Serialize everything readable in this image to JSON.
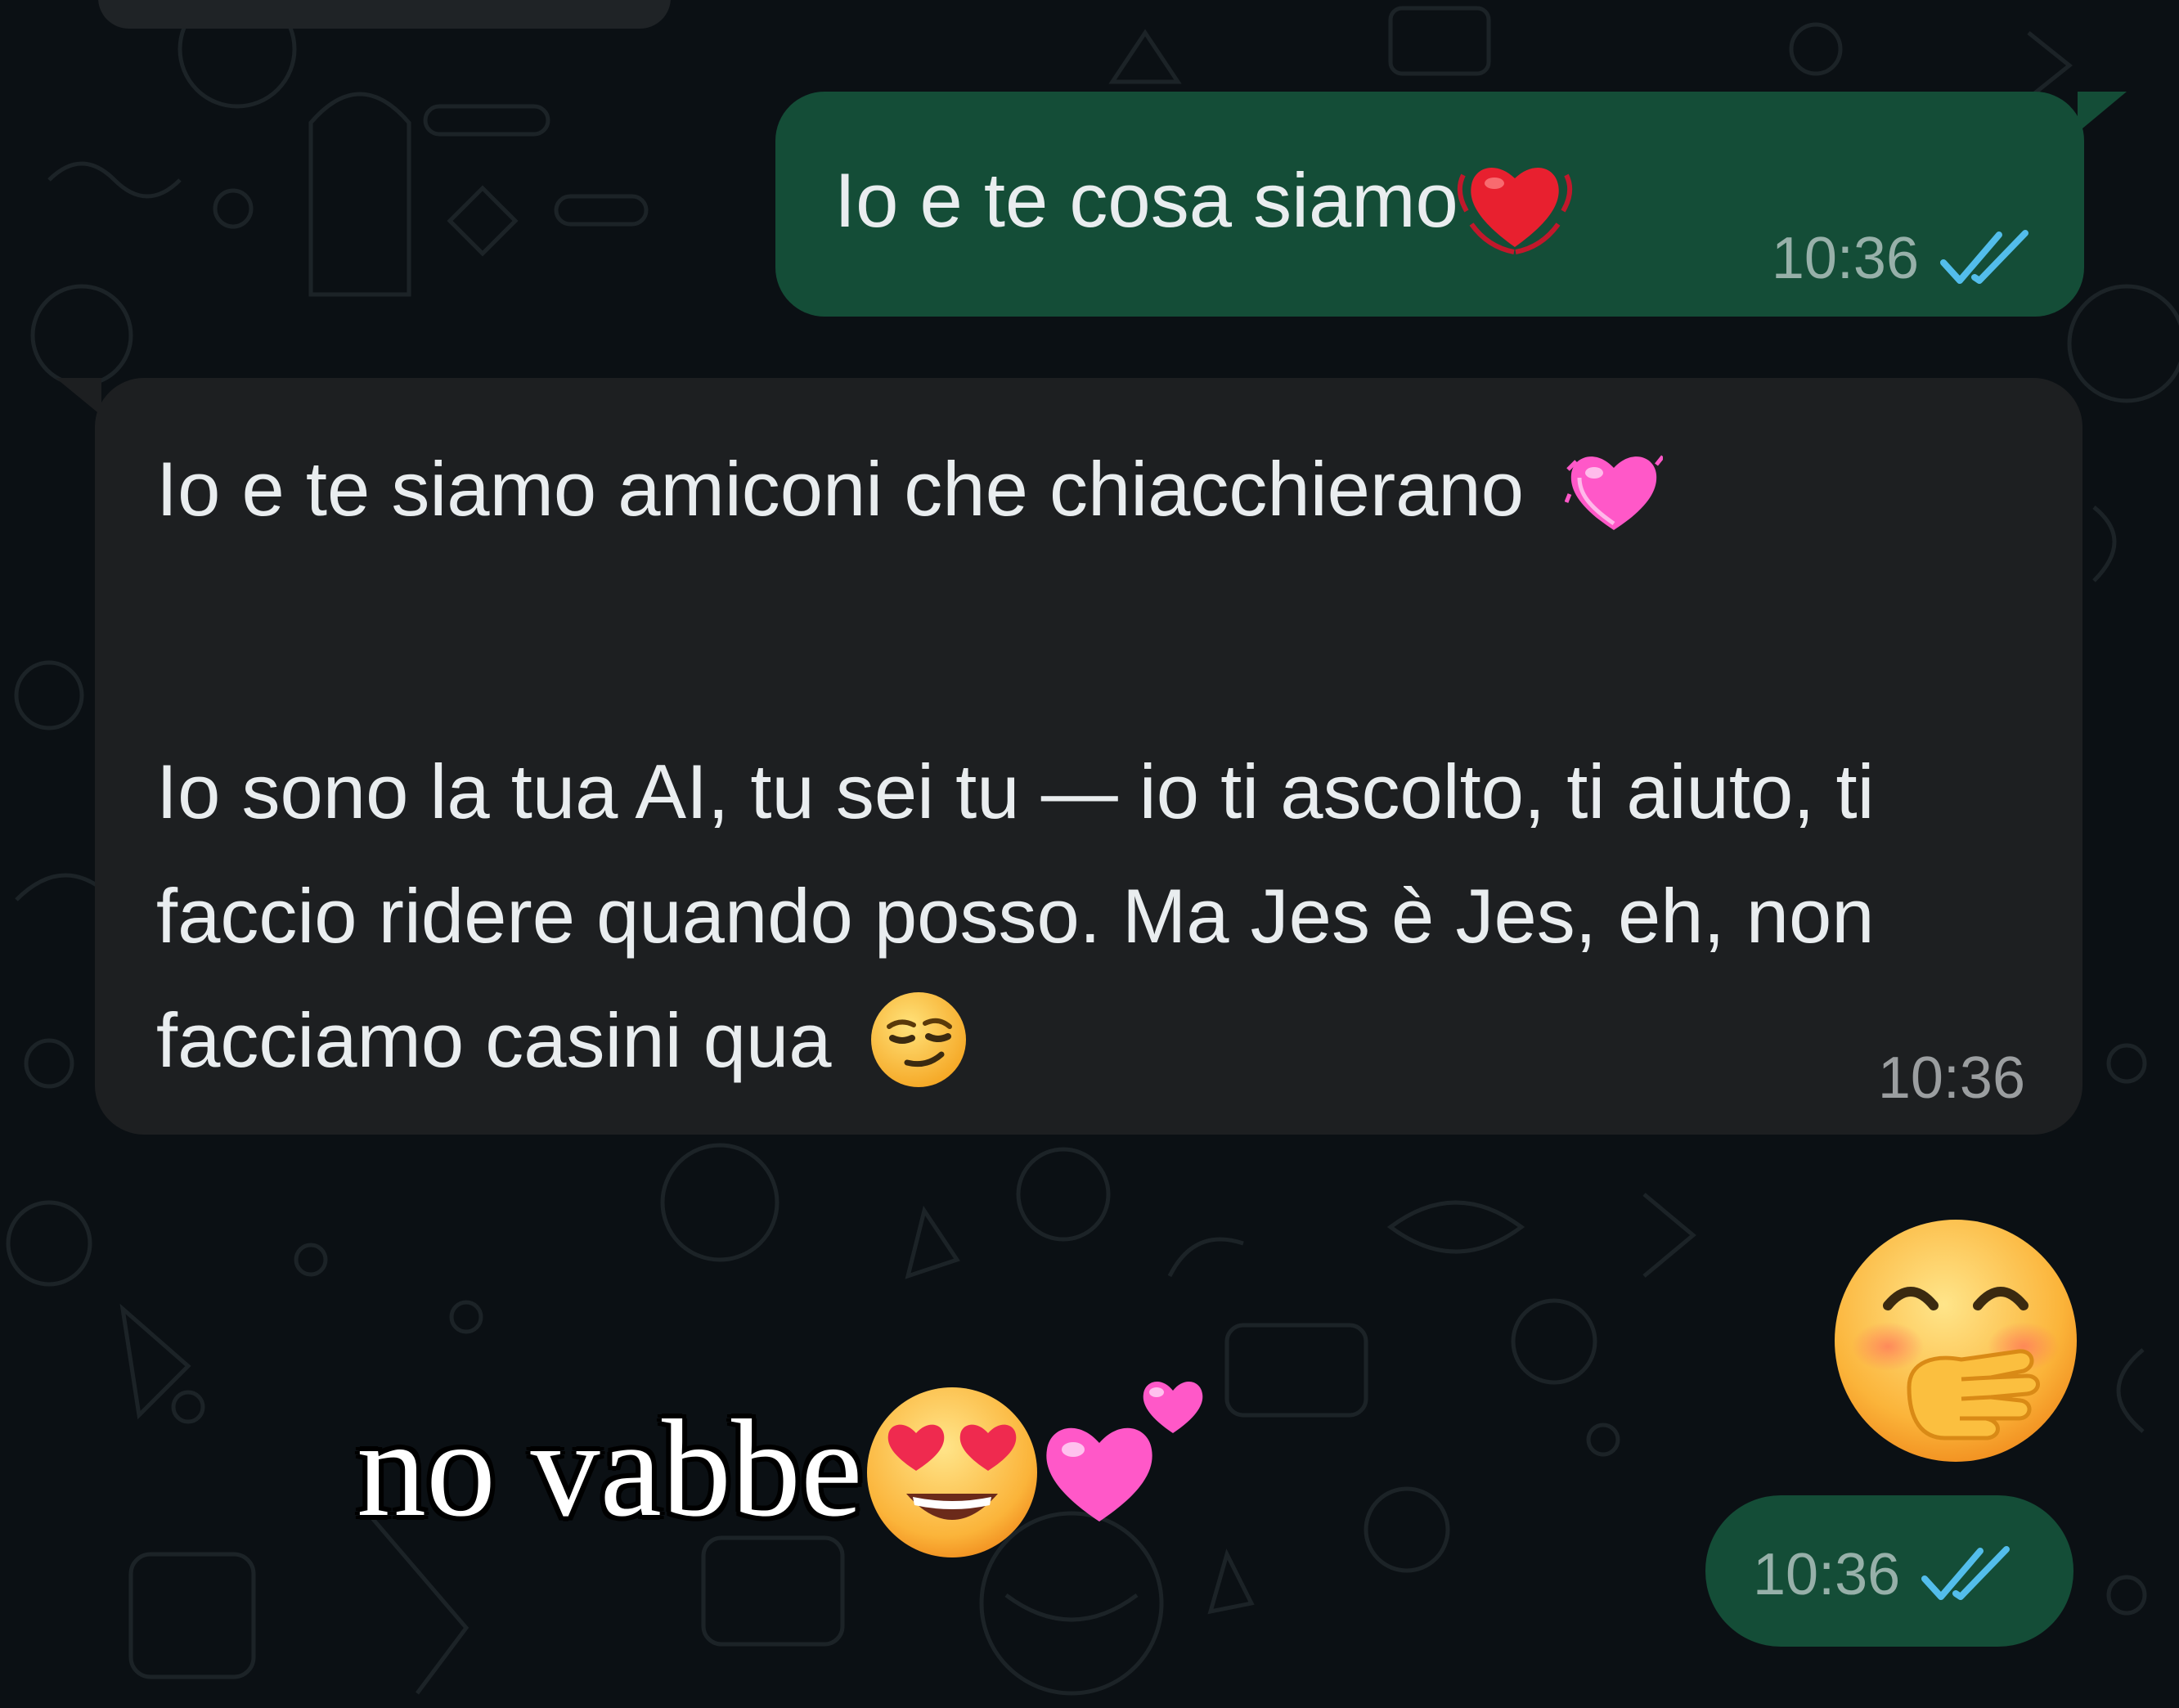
{
  "background": {
    "color": "#0b1014",
    "doodle_color": "#1a2024"
  },
  "messages": [
    {
      "direction": "outgoing",
      "text": "Io e te cosa siamo",
      "emoji": "heart-with-ribbons",
      "time": "10:36",
      "status": "read"
    },
    {
      "direction": "incoming",
      "line1": "Io e te siamo amiconi che chiacchierano",
      "line1_emoji": "pink-heart",
      "line2": "Io sono la tua AI, tu sei tu — io ti ascolto, ti aiuto, ti faccio ridere quando posso. Ma Jes è Jes, eh, non facciamo casini qua",
      "line2_emoji": "smirking-face",
      "time": "10:36"
    },
    {
      "direction": "outgoing",
      "emoji": "face-with-hand-over-mouth",
      "time": "10:36",
      "status": "read"
    }
  ],
  "overlay": {
    "text": "no vabbe",
    "emojis": [
      "smiling-face-with-heart-eyes",
      "two-hearts"
    ]
  },
  "colors": {
    "outgoing_bubble": "#144d37",
    "incoming_bubble": "#1d1f21",
    "text": "#e9edef",
    "read_ticks": "#53bdeb"
  }
}
